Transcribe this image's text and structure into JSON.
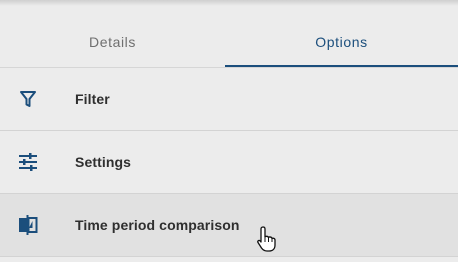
{
  "tabs": [
    {
      "label": "Details",
      "active": false
    },
    {
      "label": "Options",
      "active": true
    }
  ],
  "menu": {
    "items": [
      {
        "label": "Filter",
        "icon": "filter-icon"
      },
      {
        "label": "Settings",
        "icon": "sliders-icon"
      },
      {
        "label": "Time period comparison",
        "icon": "compare-icon"
      }
    ]
  },
  "colors": {
    "accent": "#1b4e7c",
    "background": "#ececec",
    "hover": "#e1e1e1"
  }
}
